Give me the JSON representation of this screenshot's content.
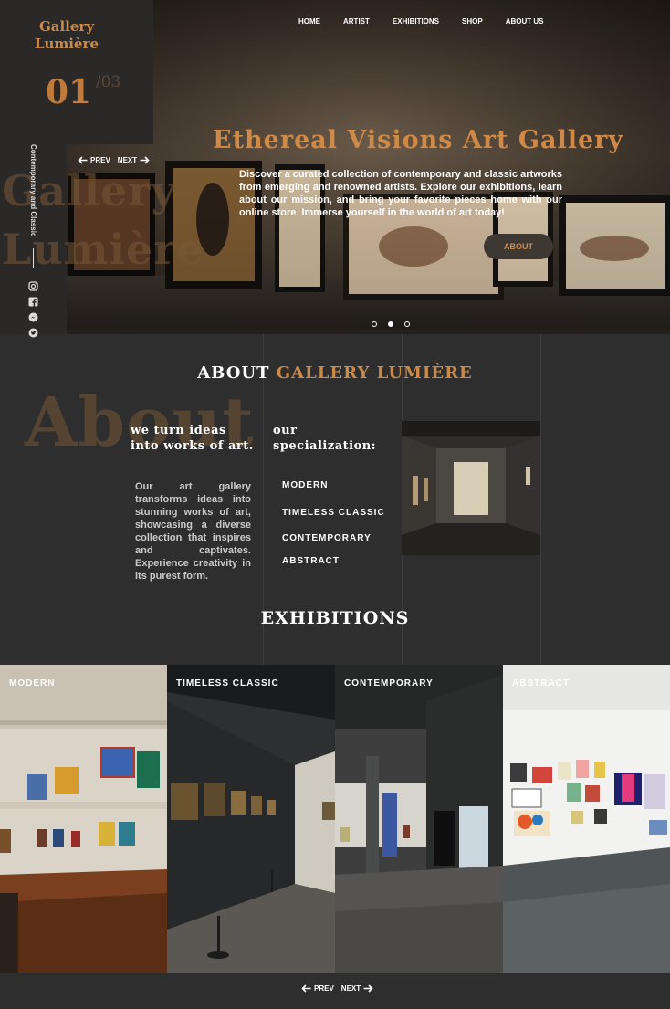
{
  "brand": {
    "line1": "Gallery",
    "line2": "Lumière"
  },
  "slider": {
    "current": "01",
    "total": "/03",
    "prev_label": "PREV",
    "next_label": "NEXT",
    "dot_count": 3,
    "active_dot": 2
  },
  "hero_ghost": {
    "line1": "Gallery",
    "line2": "Lumière"
  },
  "vertical_label": "Contemporary and Classic",
  "social_icons": [
    "instagram-icon",
    "facebook-icon",
    "messenger-icon",
    "twitter-icon"
  ],
  "nav": {
    "items": [
      "HOME",
      "ARTIST",
      "EXHIBITIONS",
      "SHOP",
      "ABOUT US"
    ]
  },
  "hero": {
    "title": "Ethereal Visions Art Gallery",
    "description": "Discover a curated collection of contemporary and classic artworks from emerging and renowned artists. Explore our exhibitions, learn about our mission, and bring your favorite pieces home with our online store. Immerse yourself in the world of art today!",
    "button_label": "ABOUT"
  },
  "about": {
    "heading_white": "ABOUT ",
    "heading_accent": "GALLERY LUMIÈRE",
    "ghost": "About",
    "col1_title": "we turn ideas into works of art.",
    "col1_text": "Our art gallery transforms ideas into stunning works of art, showcasing a diverse collection that inspires and captivates. Experience creativity in its purest form.",
    "col2_title": "our specialization:",
    "specializations": [
      "MODERN",
      "TIMELESS CLASSIC",
      "CONTEMPORARY",
      "ABSTRACT"
    ]
  },
  "exhibitions": {
    "heading": "EXHIBITIONS",
    "cards": [
      {
        "label": "MODERN"
      },
      {
        "label": "TIMELESS CLASSIC"
      },
      {
        "label": "CONTEMPORARY"
      },
      {
        "label": "ABSTRACT"
      }
    ],
    "prev_label": "PREV",
    "next_label": "NEXT"
  },
  "colors": {
    "accent": "#c98a4b",
    "background": "#2e2e2e",
    "panel": "#2a2928"
  }
}
